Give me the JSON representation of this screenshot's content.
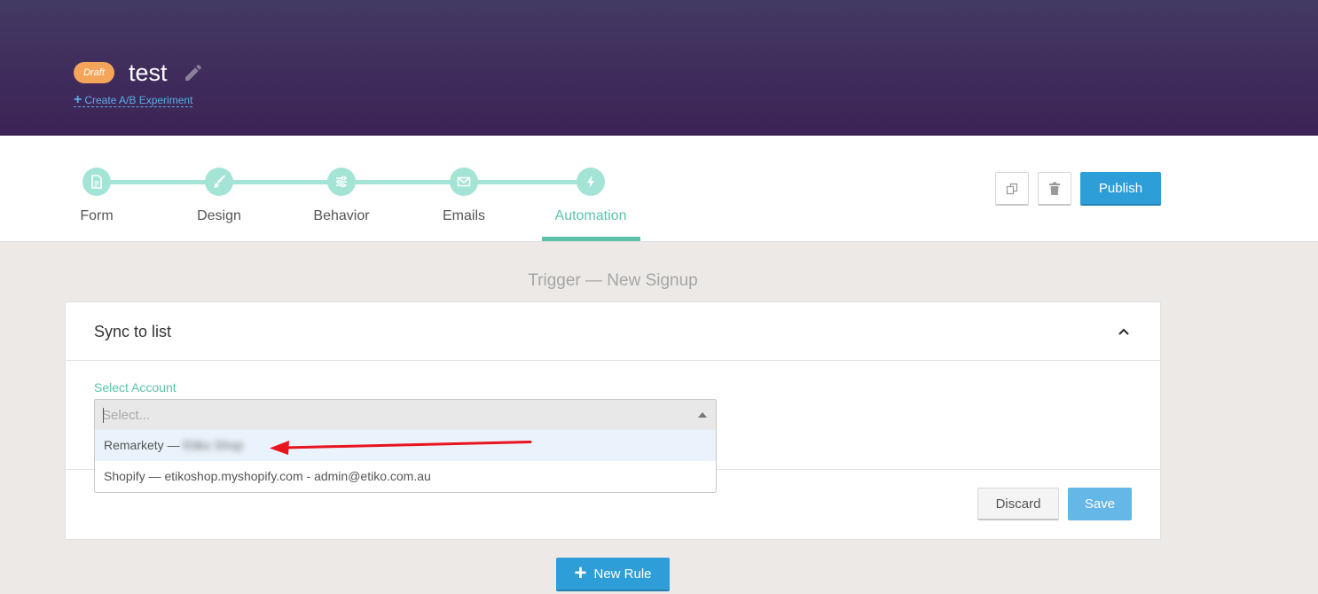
{
  "header": {
    "badge": "Draft",
    "title": "test",
    "ab_link": "Create A/B Experiment"
  },
  "steps": [
    {
      "label": "Form",
      "icon": "document-icon"
    },
    {
      "label": "Design",
      "icon": "brush-icon"
    },
    {
      "label": "Behavior",
      "icon": "sliders-icon"
    },
    {
      "label": "Emails",
      "icon": "envelope-icon"
    },
    {
      "label": "Automation",
      "icon": "lightning-icon",
      "active": true
    }
  ],
  "toolbar": {
    "publish_label": "Publish"
  },
  "main": {
    "trigger_title": "Trigger — New Signup",
    "card_title": "Sync to list",
    "field_label": "Select Account",
    "select_placeholder": "Select...",
    "options": [
      {
        "prefix": "Remarkety — ",
        "detail": "Etiko Shop"
      },
      {
        "prefix": "Shopify — ",
        "detail": "etikoshop.myshopify.com - admin@etiko.com.au"
      }
    ],
    "discard_label": "Discard",
    "save_label": "Save",
    "new_rule_label": "New Rule"
  },
  "colors": {
    "header_top": "#433a63",
    "header_bottom": "#3c2455",
    "accent_green": "#5bc4a8",
    "step_track": "#a4e4d6",
    "primary_blue": "#2e9ed8",
    "draft_orange": "#f4a55a",
    "annotation_red": "#e8141e"
  }
}
